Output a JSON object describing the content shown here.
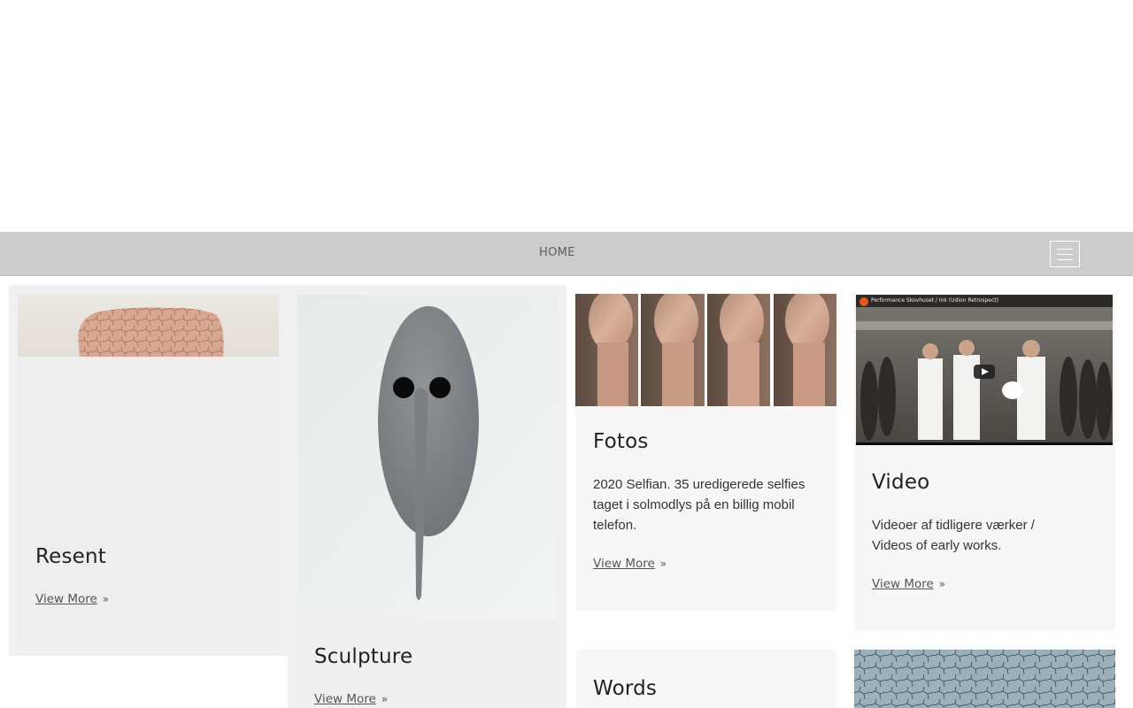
{
  "nav": {
    "home_label": "HOME"
  },
  "cards": {
    "resent": {
      "title": "Resent",
      "link": "View More"
    },
    "sculpture": {
      "title": "Sculpture",
      "link": "View More"
    },
    "fotos": {
      "title": "Fotos",
      "text": "2020 Selfian. 35 uredigerede selfies taget i solmodlys på en billig mobil telefon.",
      "link": "View More"
    },
    "video": {
      "title": "Video",
      "text": "Videoer af tidligere værker / Videos of early works.",
      "link": "View More",
      "player_title": "Performance Skovhuset / Ink (Udion Retrospect)"
    },
    "words": {
      "title": "Words"
    }
  },
  "icons": {
    "chevron": "double-chevron-right-icon",
    "menu": "hamburger-menu-icon",
    "play": "play-icon"
  },
  "colors": {
    "navbar": "#cccccc",
    "card_bg": "#f0f0f0",
    "card_bg_light": "#f7f7f7"
  }
}
